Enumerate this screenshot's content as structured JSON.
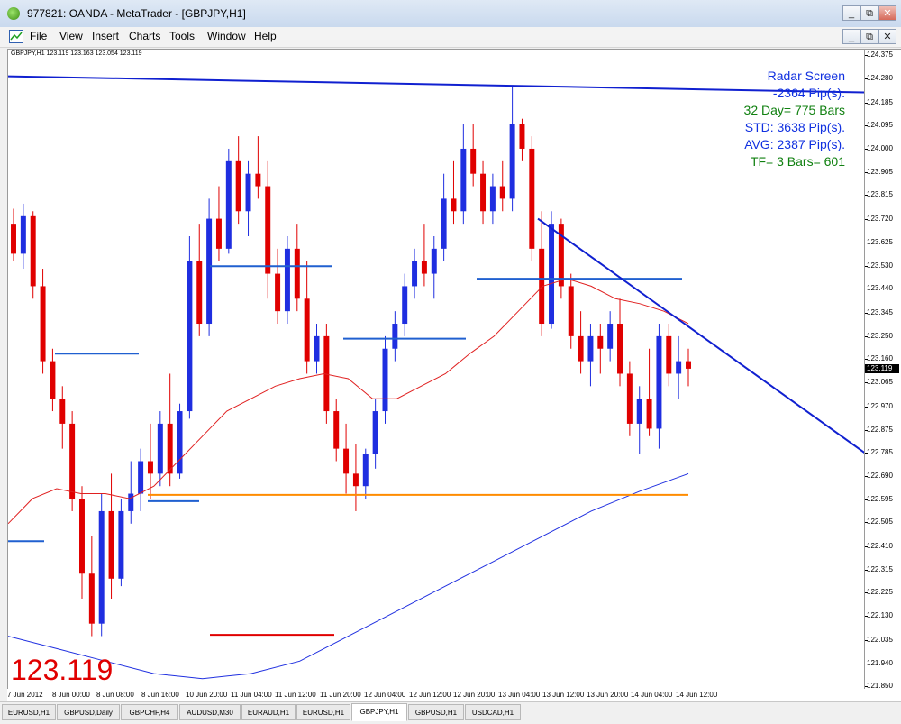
{
  "window": {
    "title": "977821: OANDA - MetaTrader - [GBPJPY,H1]",
    "controls": [
      "_",
      "⧉",
      "✕"
    ],
    "inner_controls": [
      "_",
      "⧉",
      "✕"
    ]
  },
  "menu": [
    "File",
    "View",
    "Insert",
    "Charts",
    "Tools",
    "Window",
    "Help"
  ],
  "chart": {
    "info": "GBPJPY,H1  123.119 123.163 123.054 123.119",
    "current_price": "123.119",
    "big_price": "123.119",
    "radar": {
      "line1": "Radar Screen",
      "line2": "-2364 Pip(s).",
      "line3": "32 Day= 775 Bars",
      "line4": "STD: 3638 Pip(s).",
      "line5": "AVG: 2387 Pip(s).",
      "line6": "TF= 3 Bars= 601"
    },
    "colors": {
      "bull": "#1f2ee0",
      "bear": "#e00000",
      "trendline": "#1020d0",
      "support": "#ff8c00",
      "ma_red": "#e02020",
      "ma_blue": "#2030e0",
      "radar_blue": "#1030e0",
      "radar_green": "#108010"
    }
  },
  "price_axis": [
    "124.375",
    "124.280",
    "124.185",
    "124.095",
    "124.000",
    "123.905",
    "123.815",
    "123.720",
    "123.625",
    "123.530",
    "123.440",
    "123.345",
    "123.250",
    "123.160",
    "123.065",
    "122.970",
    "122.875",
    "122.785",
    "122.690",
    "122.595",
    "122.505",
    "122.410",
    "122.315",
    "122.225",
    "122.130",
    "122.035",
    "121.940",
    "121.850"
  ],
  "time_axis": [
    "7 Jun 2012",
    "8 Jun 00:00",
    "8 Jun 08:00",
    "8 Jun 16:00",
    "10 Jun 20:00",
    "11 Jun 04:00",
    "11 Jun 12:00",
    "11 Jun 20:00",
    "12 Jun 04:00",
    "12 Jun 12:00",
    "12 Jun 20:00",
    "13 Jun 04:00",
    "13 Jun 12:00",
    "13 Jun 20:00",
    "14 Jun 04:00",
    "14 Jun 12:00"
  ],
  "tabs": [
    "EURUSD,H1",
    "GBPUSD,Daily",
    "GBPCHF,H4",
    "AUDUSD,M30",
    "EURAUD,H1",
    "EURUSD,H1",
    "GBPJPY,H1",
    "GBPUSD,H1",
    "USDCAD,H1"
  ],
  "active_tab": "GBPJPY,H1",
  "chart_data": {
    "type": "candlestick",
    "symbol": "GBPJPY",
    "timeframe": "H1",
    "ylim": [
      121.85,
      124.375
    ],
    "candles": [
      [
        123.7,
        123.76,
        123.55,
        123.58
      ],
      [
        123.58,
        123.78,
        123.52,
        123.73
      ],
      [
        123.73,
        123.75,
        123.4,
        123.45
      ],
      [
        123.45,
        123.52,
        123.1,
        123.15
      ],
      [
        123.15,
        123.2,
        122.95,
        123.0
      ],
      [
        123.0,
        123.05,
        122.8,
        122.9
      ],
      [
        122.9,
        122.95,
        122.55,
        122.6
      ],
      [
        122.6,
        122.65,
        122.2,
        122.3
      ],
      [
        122.3,
        122.45,
        122.05,
        122.1
      ],
      [
        122.1,
        122.62,
        122.05,
        122.55
      ],
      [
        122.55,
        122.7,
        122.2,
        122.28
      ],
      [
        122.28,
        122.6,
        122.25,
        122.55
      ],
      [
        122.55,
        122.75,
        122.5,
        122.62
      ],
      [
        122.62,
        122.8,
        122.55,
        122.75
      ],
      [
        122.75,
        122.9,
        122.6,
        122.7
      ],
      [
        122.7,
        122.95,
        122.65,
        122.9
      ],
      [
        122.9,
        123.1,
        122.65,
        122.7
      ],
      [
        122.7,
        122.98,
        122.68,
        122.95
      ],
      [
        122.95,
        123.65,
        122.92,
        123.55
      ],
      [
        123.55,
        123.7,
        123.25,
        123.3
      ],
      [
        123.3,
        123.8,
        123.25,
        123.72
      ],
      [
        123.72,
        123.85,
        123.55,
        123.6
      ],
      [
        123.6,
        124.0,
        123.58,
        123.95
      ],
      [
        123.95,
        124.05,
        123.7,
        123.75
      ],
      [
        123.75,
        123.95,
        123.65,
        123.9
      ],
      [
        123.9,
        124.05,
        123.8,
        123.85
      ],
      [
        123.85,
        123.95,
        123.4,
        123.5
      ],
      [
        123.5,
        123.6,
        123.3,
        123.35
      ],
      [
        123.35,
        123.65,
        123.3,
        123.6
      ],
      [
        123.6,
        123.7,
        123.35,
        123.4
      ],
      [
        123.4,
        123.55,
        123.1,
        123.15
      ],
      [
        123.15,
        123.3,
        123.1,
        123.25
      ],
      [
        123.25,
        123.3,
        122.9,
        122.95
      ],
      [
        122.95,
        123.0,
        122.75,
        122.8
      ],
      [
        122.8,
        122.9,
        122.62,
        122.7
      ],
      [
        122.7,
        122.82,
        122.55,
        122.65
      ],
      [
        122.65,
        122.8,
        122.6,
        122.78
      ],
      [
        122.78,
        123.0,
        122.72,
        122.95
      ],
      [
        122.95,
        123.25,
        122.9,
        123.2
      ],
      [
        123.2,
        123.35,
        123.15,
        123.3
      ],
      [
        123.3,
        123.5,
        123.25,
        123.45
      ],
      [
        123.45,
        123.6,
        123.4,
        123.55
      ],
      [
        123.55,
        123.7,
        123.45,
        123.5
      ],
      [
        123.5,
        123.65,
        123.4,
        123.6
      ],
      [
        123.6,
        123.9,
        123.55,
        123.8
      ],
      [
        123.8,
        123.95,
        123.7,
        123.75
      ],
      [
        123.75,
        124.1,
        123.7,
        124.0
      ],
      [
        124.0,
        124.1,
        123.85,
        123.9
      ],
      [
        123.9,
        123.95,
        123.7,
        123.75
      ],
      [
        123.75,
        123.9,
        123.7,
        123.85
      ],
      [
        123.85,
        123.95,
        123.75,
        123.8
      ],
      [
        123.8,
        124.25,
        123.75,
        124.1
      ],
      [
        124.1,
        124.12,
        123.95,
        124.0
      ],
      [
        124.0,
        124.05,
        123.55,
        123.6
      ],
      [
        123.6,
        123.75,
        123.25,
        123.3
      ],
      [
        123.3,
        123.75,
        123.28,
        123.7
      ],
      [
        123.7,
        123.72,
        123.4,
        123.45
      ],
      [
        123.45,
        123.5,
        123.2,
        123.25
      ],
      [
        123.25,
        123.35,
        123.1,
        123.15
      ],
      [
        123.15,
        123.3,
        123.05,
        123.25
      ],
      [
        123.25,
        123.3,
        123.1,
        123.2
      ],
      [
        123.2,
        123.35,
        123.15,
        123.3
      ],
      [
        123.3,
        123.4,
        123.05,
        123.1
      ],
      [
        123.1,
        123.15,
        122.85,
        122.9
      ],
      [
        122.9,
        123.05,
        122.78,
        123.0
      ],
      [
        123.0,
        123.2,
        122.85,
        122.88
      ],
      [
        122.88,
        123.3,
        122.8,
        123.25
      ],
      [
        123.25,
        123.3,
        123.05,
        123.1
      ],
      [
        123.1,
        123.25,
        123.0,
        123.15
      ],
      [
        123.15,
        123.2,
        123.05,
        123.12
      ]
    ],
    "ma_red": [
      122.5,
      122.6,
      122.64,
      122.62,
      122.62,
      122.6,
      122.65,
      122.75,
      122.85,
      122.95,
      123.0,
      123.05,
      123.08,
      123.1,
      123.08,
      123.0,
      123.0,
      123.05,
      123.1,
      123.18,
      123.25,
      123.35,
      123.45,
      123.48,
      123.45,
      123.4,
      123.38,
      123.35,
      123.3
    ],
    "ma_blue": [
      122.05,
      122.0,
      121.95,
      121.9,
      121.88,
      121.9,
      121.95,
      122.05,
      122.15,
      122.25,
      122.35,
      122.45,
      122.55,
      122.63,
      122.7
    ],
    "levels": [
      {
        "price": 122.615,
        "color": "#ff8c00"
      },
      {
        "price": 123.29,
        "color": "#2060d0"
      },
      {
        "price": 122.055,
        "color": "#e00000"
      }
    ]
  }
}
